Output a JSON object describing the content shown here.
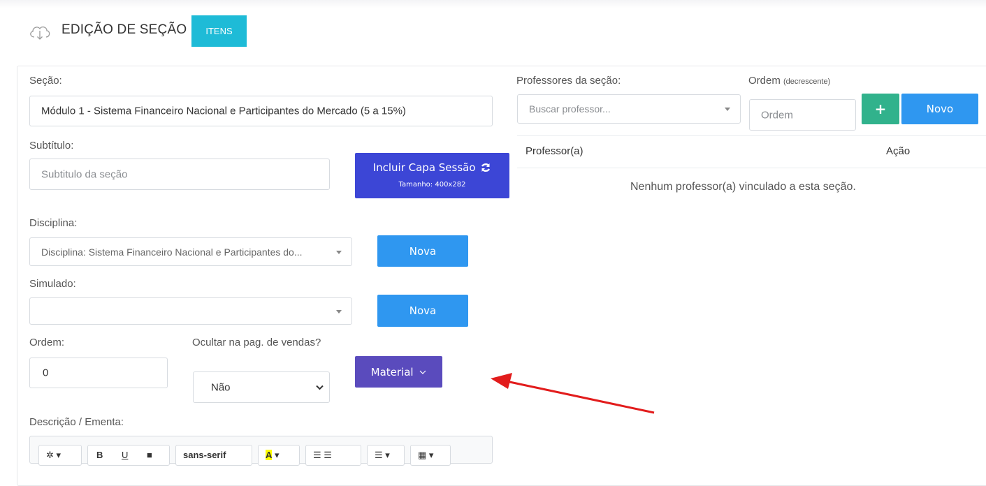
{
  "header": {
    "title": "EDIÇÃO DE SEÇÃO",
    "items_button": "ITENS",
    "icon": "cloud-icon"
  },
  "form": {
    "secao_label": "Seção:",
    "secao_value": "Módulo 1 - Sistema Financeiro Nacional e Participantes do Mercado (5 a 15%)",
    "subtitulo_label": "Subtítulo:",
    "subtitulo_placeholder": "Subtitulo da seção",
    "capa_button": "Incluir Capa Sessão",
    "capa_size": "Tamanho: 400x282",
    "disciplina_label": "Disciplina:",
    "disciplina_value": "Disciplina: Sistema Financeiro Nacional e Participantes do...",
    "nova_button": "Nova",
    "simulado_label": "Simulado:",
    "simulado_value": "",
    "ordem_label": "Ordem:",
    "ordem_value": "0",
    "ocultar_label": "Ocultar na pag. de vendas?",
    "ocultar_value": "Não",
    "material_button": "Material",
    "descricao_label": "Descrição / Ementa:"
  },
  "professores": {
    "label": "Professores da seção:",
    "search_placeholder": "Buscar professor...",
    "ordem_label": "Ordem",
    "ordem_sub": "(decrescente)",
    "ordem_placeholder": "Ordem",
    "add_button": "+",
    "novo_button": "Novo",
    "columns": [
      "Professor(a)",
      "Ação"
    ],
    "empty_text": "Nenhum professor(a) vinculado a esta seção."
  },
  "editor_toolbar": {
    "font_family": "sans-serif"
  },
  "colors": {
    "itens": "#1ebbd7",
    "blue": "#2f97f0",
    "indigo": "#3c46d6",
    "purple": "#5a4bbd",
    "green": "#31b28c",
    "arrow": "#e21c1c"
  }
}
